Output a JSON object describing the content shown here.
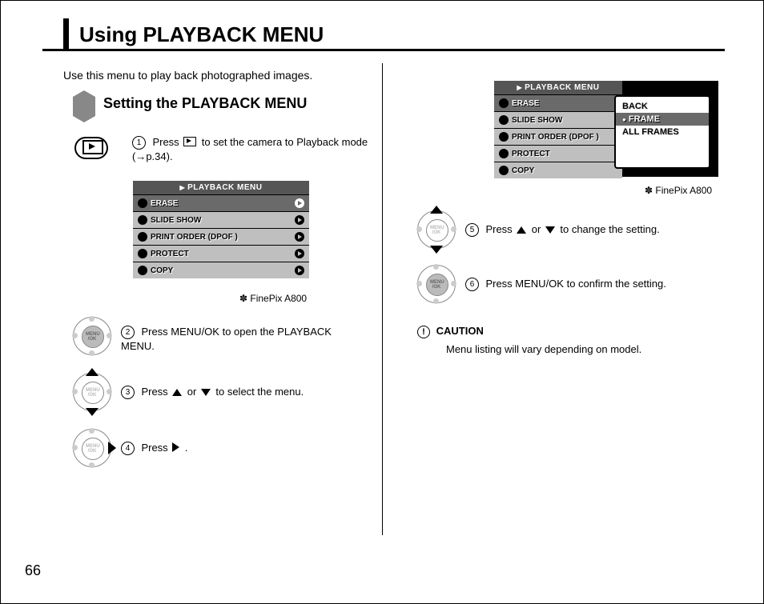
{
  "page_number": "66",
  "title": "Using PLAYBACK MENU",
  "intro": "Use this menu to play back photographed images.",
  "section_heading": "Setting the PLAYBACK MENU",
  "model_note": "FinePix A800",
  "steps": {
    "s1a": "Press ",
    "s1b": " to set the camera to Playback mode (→p.34).",
    "s2": "Press MENU/OK to open the PLAYBACK MENU.",
    "s3a": "Press ",
    "s3b": " or ",
    "s3c": " to select the menu.",
    "s4a": "Press ",
    "s4b": ".",
    "s5a": "Press ",
    "s5b": " or ",
    "s5c": " to change the setting.",
    "s6": "Press MENU/OK to confirm the setting."
  },
  "screen1": {
    "title": "PLAYBACK MENU",
    "items": [
      "ERASE",
      "SLIDE SHOW",
      "PRINT ORDER (DPOF )",
      "PROTECT",
      "COPY"
    ],
    "selected": 0
  },
  "screen2": {
    "title": "PLAYBACK MENU",
    "items": [
      "ERASE",
      "SLIDE SHOW",
      "PRINT ORDER (DPOF )",
      "PROTECT",
      "COPY"
    ],
    "selected": 0,
    "sub_items": [
      "BACK",
      "FRAME",
      "ALL FRAMES"
    ],
    "sub_selected": 1
  },
  "caution_label": "CAUTION",
  "caution_text": "Menu listing will vary depending on model."
}
